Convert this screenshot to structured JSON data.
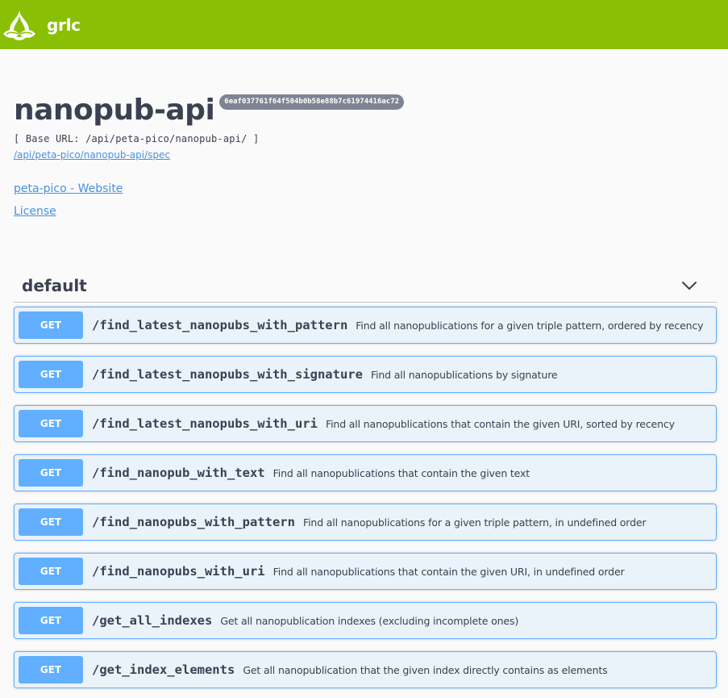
{
  "app": {
    "logo_text": "grlc",
    "logo_icon": "grlc-leaf-icon",
    "brand_color": "#89bf04"
  },
  "info": {
    "title": "nanopub-api",
    "version": "6eaf037761f64f504b0b58e88b7c61974416ac72",
    "base_url": "[ Base URL: /api/peta-pico/nanopub-api/ ]",
    "spec_link": "/api/peta-pico/nanopub-api/spec",
    "links": [
      "peta-pico - Website",
      "License"
    ]
  },
  "tag": {
    "name": "default",
    "toggle_icon": "chevron-down-icon"
  },
  "operations": [
    {
      "method": "GET",
      "path": "/find_latest_nanopubs_with_pattern",
      "summary": "Find all nanopublications for a given triple pattern, ordered by recency"
    },
    {
      "method": "GET",
      "path": "/find_latest_nanopubs_with_signature",
      "summary": "Find all nanopublications by signature"
    },
    {
      "method": "GET",
      "path": "/find_latest_nanopubs_with_uri",
      "summary": "Find all nanopublications that contain the given URI, sorted by recency"
    },
    {
      "method": "GET",
      "path": "/find_nanopub_with_text",
      "summary": "Find all nanopublications that contain the given text"
    },
    {
      "method": "GET",
      "path": "/find_nanopubs_with_pattern",
      "summary": "Find all nanopublications for a given triple pattern, in undefined order"
    },
    {
      "method": "GET",
      "path": "/find_nanopubs_with_uri",
      "summary": "Find all nanopublications that contain the given URI, in undefined order"
    },
    {
      "method": "GET",
      "path": "/get_all_indexes",
      "summary": "Get all nanopublication indexes (excluding incomplete ones)"
    },
    {
      "method": "GET",
      "path": "/get_index_elements",
      "summary": "Get all nanopublication that the given index directly contains as elements"
    }
  ],
  "colors": {
    "get_method": "#61affe",
    "link": "#4990e2",
    "text": "#3b4151"
  }
}
